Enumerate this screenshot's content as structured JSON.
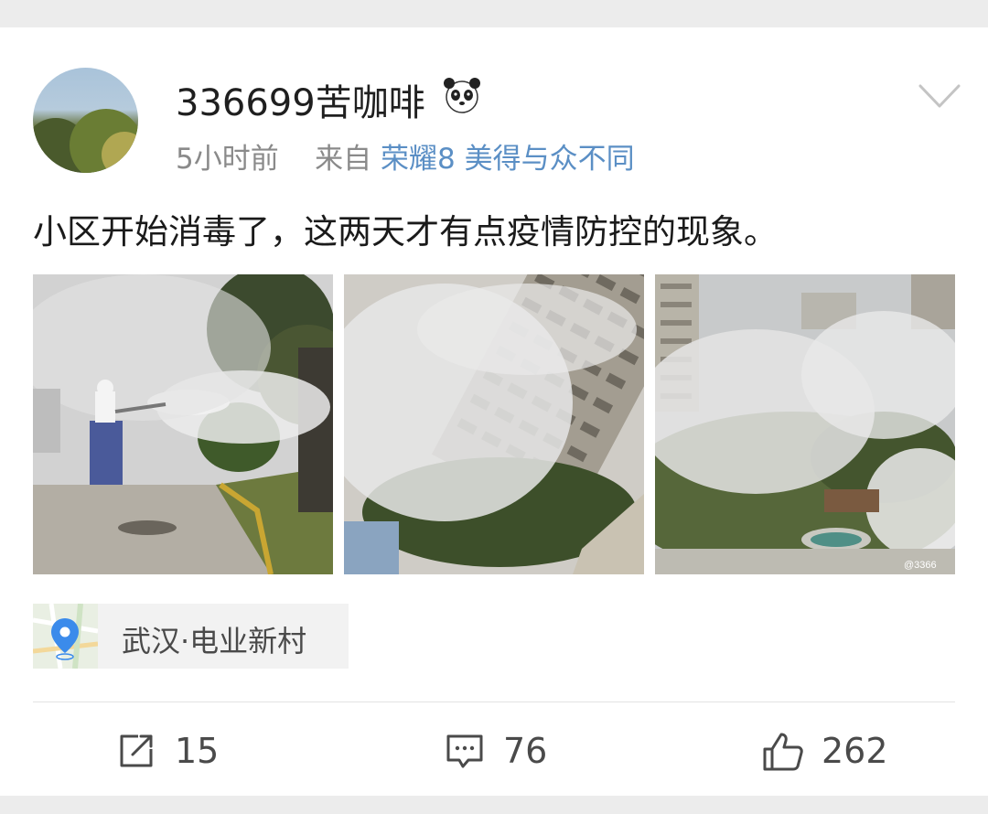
{
  "post": {
    "username": "336699苦咖啡",
    "badge_icon": "panda-icon",
    "time": "5小时前",
    "from_label": "来自",
    "source": "荣耀8 美得与众不同",
    "text": "小区开始消毒了，这两天才有点疫情防控的现象。",
    "images": [
      {
        "icon": "photo-street-disinfection"
      },
      {
        "icon": "photo-building-fog"
      },
      {
        "icon": "photo-courtyard-fog",
        "watermark": "@3366"
      }
    ],
    "location": {
      "icon": "map-pin-icon",
      "text": "武汉·电业新村"
    },
    "actions": {
      "repost": {
        "icon": "share-icon",
        "count": "15"
      },
      "comment": {
        "icon": "comment-icon",
        "count": "76"
      },
      "like": {
        "icon": "thumbs-up-icon",
        "count": "262"
      }
    }
  },
  "colors": {
    "background": "#ececec",
    "card": "#ffffff",
    "username": "#1f1f1f",
    "meta": "#8a8a8a",
    "source_link": "#5b8fc5",
    "icon": "#4a4a4a",
    "location_pin": "#3b8beb"
  }
}
